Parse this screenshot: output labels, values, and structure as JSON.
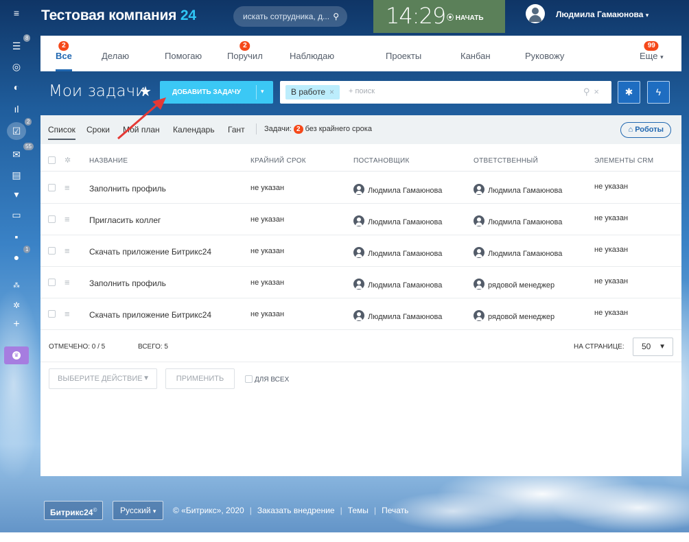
{
  "header": {
    "company_name": "Тестовая компания",
    "company_suffix": "24",
    "search_placeholder": "искать сотрудника, д...",
    "clock": "14:29",
    "start_label": "⦿ НАЧАТЬ",
    "user_name": "Людмила Гамаюнова"
  },
  "rail": {
    "badges": {
      "feed": "8",
      "tasks": "2",
      "mail": "55",
      "approvals": "1"
    }
  },
  "tabs": [
    {
      "label": "Все",
      "count": "2"
    },
    {
      "label": "Делаю"
    },
    {
      "label": "Помогаю"
    },
    {
      "label": "Поручил",
      "count": "2"
    },
    {
      "label": "Наблюдаю"
    },
    {
      "label": "Проекты"
    },
    {
      "label": "Канбан"
    },
    {
      "label": "Руковожу"
    },
    {
      "label": "Еще",
      "count": "99"
    }
  ],
  "page": {
    "title": "Мои задачи",
    "add_button": "ДОБАВИТЬ ЗАДАЧУ",
    "filter_chip": "В работе",
    "filter_placeholder": "+ поиск"
  },
  "views": [
    "Список",
    "Сроки",
    "Мой план",
    "Календарь",
    "Гант"
  ],
  "counter": {
    "prefix": "Задачи:",
    "count": "2",
    "suffix": "без крайнего срока"
  },
  "robots_label": "Роботы",
  "columns": [
    "НАЗВАНИЕ",
    "КРАЙНИЙ СРОК",
    "ПОСТАНОВЩИК",
    "ОТВЕТСТВЕННЫЙ",
    "ЭЛЕМЕНТЫ CRM"
  ],
  "rows": [
    {
      "name": "Заполнить профиль",
      "deadline": "не указан",
      "creator": "Людмила Гамаюнова",
      "responsible": "Людмила Гамаюнова",
      "crm": "не указан"
    },
    {
      "name": "Пригласить коллег",
      "deadline": "не указан",
      "creator": "Людмила Гамаюнова",
      "responsible": "Людмила Гамаюнова",
      "crm": "не указан"
    },
    {
      "name": "Скачать приложение Битрикс24",
      "deadline": "не указан",
      "creator": "Людмила Гамаюнова",
      "responsible": "Людмила Гамаюнова",
      "crm": "не указан"
    },
    {
      "name": "Заполнить профиль",
      "deadline": "не указан",
      "creator": "Людмила Гамаюнова",
      "responsible": "рядовой менеджер",
      "crm": "не указан"
    },
    {
      "name": "Скачать приложение Битрикс24",
      "deadline": "не указан",
      "creator": "Людмила Гамаюнова",
      "responsible": "рядовой менеджер",
      "crm": "не указан"
    }
  ],
  "grid_footer": {
    "selected": "ОТМЕЧЕНО: 0 / 5",
    "total": "ВСЕГО: 5",
    "per_page_label": "НА СТРАНИЦЕ:",
    "per_page_value": "50"
  },
  "actions": {
    "select_action": "ВЫБЕРИТЕ ДЕЙСТВИЕ",
    "apply": "ПРИМЕНИТЬ",
    "for_all": "ДЛЯ ВСЕХ"
  },
  "footer": {
    "brand": "Битрикс24",
    "language": "Русский",
    "copyright": "© «Битрикс», 2020",
    "order": "Заказать внедрение",
    "themes": "Темы",
    "print": "Печать"
  },
  "colors": {
    "accent": "#2067b0",
    "add_button": "#3bc8f5",
    "badge": "#f54819",
    "clock_bg": "#5b8059"
  }
}
